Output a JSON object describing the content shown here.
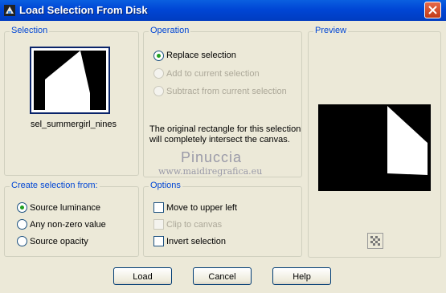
{
  "window": {
    "title": "Load Selection From Disk"
  },
  "selection": {
    "legend": "Selection",
    "filename": "sel_summergirl_nines"
  },
  "operation": {
    "legend": "Operation",
    "options": [
      {
        "label": "Replace selection",
        "checked": true,
        "enabled": true
      },
      {
        "label": "Add to current selection",
        "checked": false,
        "enabled": false
      },
      {
        "label": "Subtract from current selection",
        "checked": false,
        "enabled": false
      }
    ],
    "note": "The original rectangle for this selection will completely intersect the canvas."
  },
  "watermark": {
    "name": "Pinuccia",
    "url": "www.maidiregrafica.eu"
  },
  "preview": {
    "legend": "Preview"
  },
  "create_from": {
    "legend": "Create selection from:",
    "options": [
      {
        "label": "Source luminance",
        "checked": true
      },
      {
        "label": "Any non-zero value",
        "checked": false
      },
      {
        "label": "Source opacity",
        "checked": false
      }
    ]
  },
  "options": {
    "legend": "Options",
    "items": [
      {
        "label": "Move to upper left",
        "checked": false,
        "enabled": true
      },
      {
        "label": "Clip to canvas",
        "checked": false,
        "enabled": false
      },
      {
        "label": "Invert selection",
        "checked": false,
        "enabled": true
      }
    ]
  },
  "buttons": {
    "load": "Load",
    "cancel": "Cancel",
    "help": "Help"
  },
  "colors": {
    "titlebar": "#0046d5",
    "dialog_bg": "#ece9d8",
    "legend_text": "#0046d5",
    "radio_dot": "#21a121"
  }
}
